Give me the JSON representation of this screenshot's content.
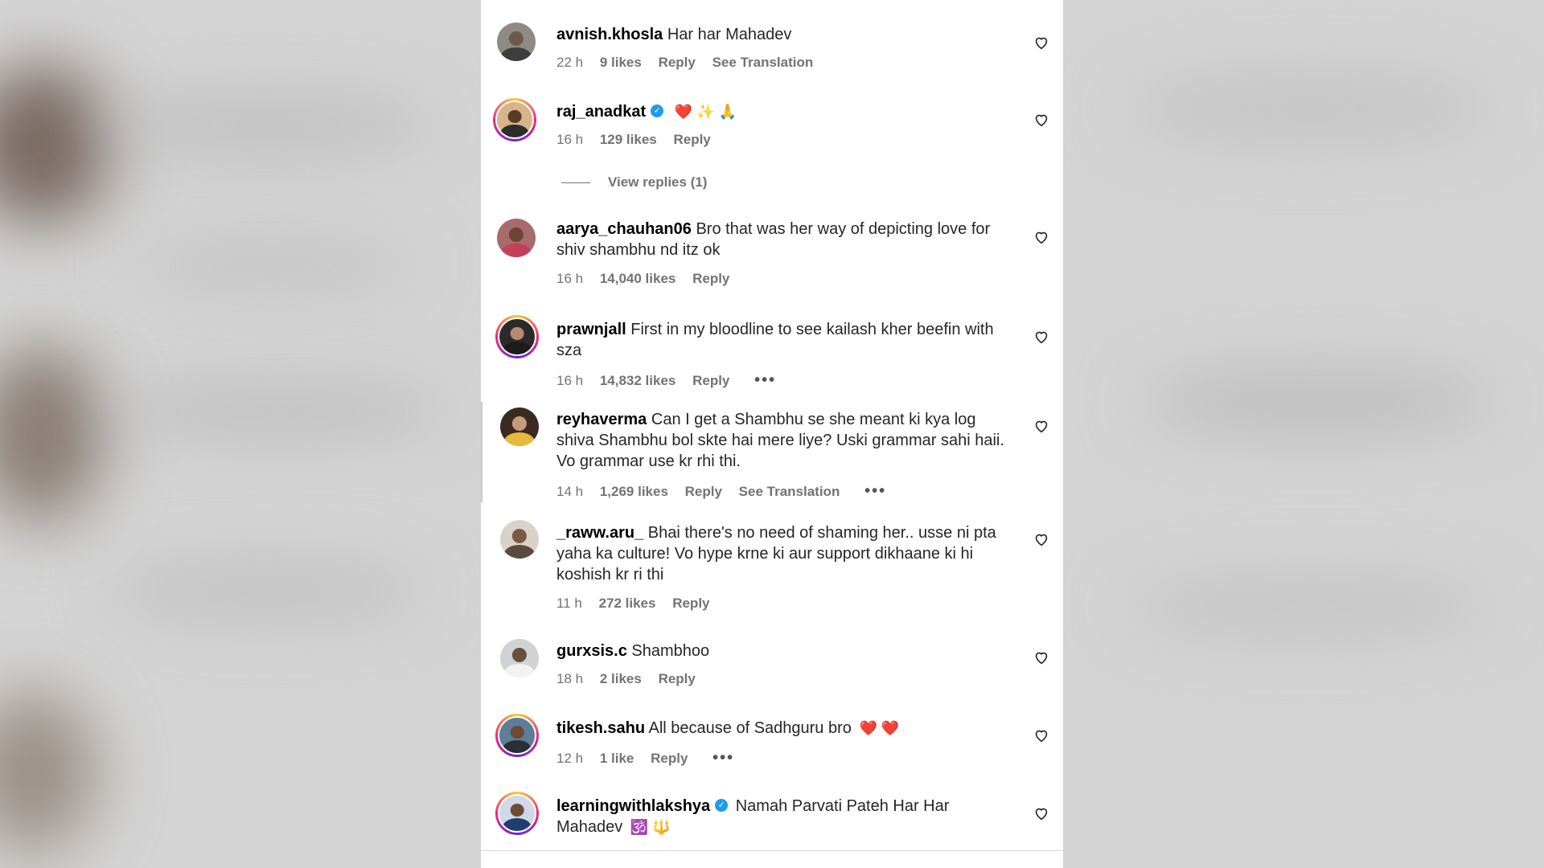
{
  "colors": {
    "accent_verified": "#1d9bf0",
    "heart_red": "#ff3040",
    "meta_gray": "#737373"
  },
  "comments": [
    {
      "username": "avnish.khosla",
      "verified": false,
      "text": "Har har Mahadev",
      "emojis": "",
      "time": "22 h",
      "likes": "9 likes",
      "reply": "Reply",
      "translation": "See Translation",
      "more": ""
    },
    {
      "username": "raj_anadkat",
      "verified": true,
      "text": "",
      "emojis": "❤️ ✨ 🙏",
      "time": "16 h",
      "likes": "129 likes",
      "reply": "Reply",
      "translation": "",
      "more": ""
    },
    {
      "username": "aarya_chauhan06",
      "verified": false,
      "text": "Bro that was her way of depicting love for shiv shambhu nd itz ok",
      "emojis": "",
      "time": "16 h",
      "likes": "14,040 likes",
      "reply": "Reply",
      "translation": "",
      "more": ""
    },
    {
      "username": "prawnjall",
      "verified": false,
      "text": "First in my bloodline to see kailash kher beefin with sza",
      "emojis": "",
      "time": "16 h",
      "likes": "14,832 likes",
      "reply": "Reply",
      "translation": "",
      "more": "•••"
    },
    {
      "username": "reyhaverma",
      "verified": false,
      "text": "Can I get a Shambhu se she meant ki kya log shiva Shambhu bol skte hai mere liye? Uski grammar sahi haii. Vo grammar use kr rhi thi.",
      "emojis": "",
      "time": "14 h",
      "likes": "1,269 likes",
      "reply": "Reply",
      "translation": "See Translation",
      "more": "•••"
    },
    {
      "username": "_raww.aru_",
      "verified": false,
      "text": "Bhai there's no need of shaming her.. usse ni pta yaha ka culture! Vo hype krne ki aur support dikhaane ki hi koshish kr ri thi",
      "emojis": "",
      "time": "11 h",
      "likes": "272 likes",
      "reply": "Reply",
      "translation": "",
      "more": ""
    },
    {
      "username": "gurxsis.c",
      "verified": false,
      "text": "Shambhoo",
      "emojis": "",
      "time": "18 h",
      "likes": "2 likes",
      "reply": "Reply",
      "translation": "",
      "more": ""
    },
    {
      "username": "tikesh.sahu",
      "verified": false,
      "text": "All because of Sadhguru bro",
      "emojis": "❤️ ❤️",
      "time": "12 h",
      "likes": "1 like",
      "reply": "Reply",
      "translation": "",
      "more": "•••"
    },
    {
      "username": "learningwithlakshya",
      "verified": true,
      "text": "Namah Parvati Pateh Har Har Mahadev",
      "emojis": "🕉️ 🔱",
      "time": "",
      "likes": "",
      "reply": "",
      "translation": "",
      "more": ""
    }
  ],
  "view_replies": "View replies (1)"
}
